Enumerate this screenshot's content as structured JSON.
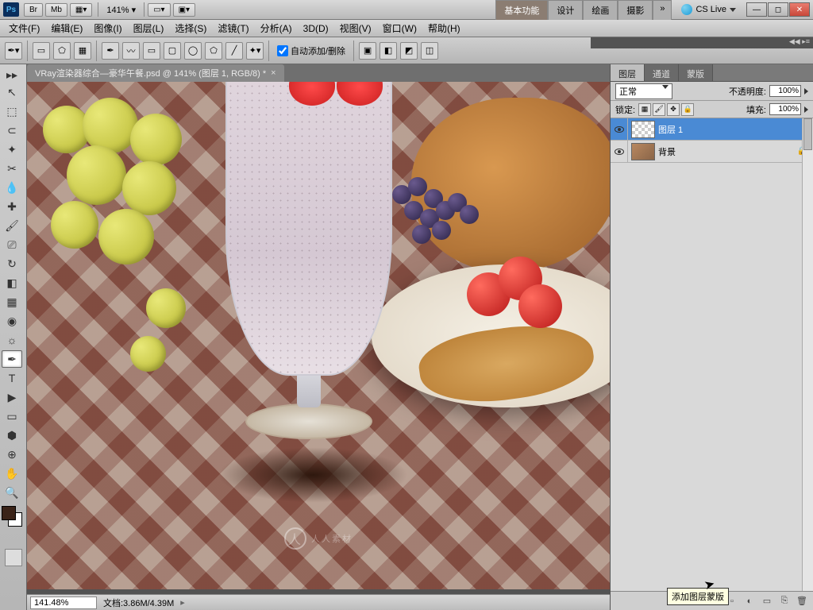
{
  "app": {
    "logo": "Ps",
    "br": "Br",
    "mb": "Mb",
    "zoom": "141%",
    "cslive": "CS Live",
    "workspaces": [
      "基本功能",
      "设计",
      "绘画",
      "摄影"
    ],
    "more": "»"
  },
  "menu": {
    "items": [
      "文件(F)",
      "编辑(E)",
      "图像(I)",
      "图层(L)",
      "选择(S)",
      "滤镜(T)",
      "分析(A)",
      "3D(D)",
      "视图(V)",
      "窗口(W)",
      "帮助(H)"
    ]
  },
  "options": {
    "autoadd": "自动添加/删除"
  },
  "doc": {
    "title": "VRay渲染器综合—豪华午餐.psd @ 141% (图层 1, RGB/8) *"
  },
  "status": {
    "zoom": "141.48%",
    "doc": "文档:3.86M/4.39M"
  },
  "watermark": "人人素材",
  "panel": {
    "tabs": [
      "图层",
      "通道",
      "蒙版"
    ],
    "blend": "正常",
    "opacity_label": "不透明度:",
    "opacity_val": "100%",
    "lock_label": "锁定:",
    "fill_label": "填充:",
    "fill_val": "100%",
    "layers": [
      {
        "name": "图层 1",
        "selected": true,
        "locked": false,
        "transparent": true
      },
      {
        "name": "背景",
        "selected": false,
        "locked": true,
        "transparent": false
      }
    ],
    "tooltip": "添加图层蒙版",
    "foot_icons": [
      "⬚",
      "fx",
      "▫",
      "◐",
      "▭",
      "⎘",
      "🗑"
    ]
  }
}
